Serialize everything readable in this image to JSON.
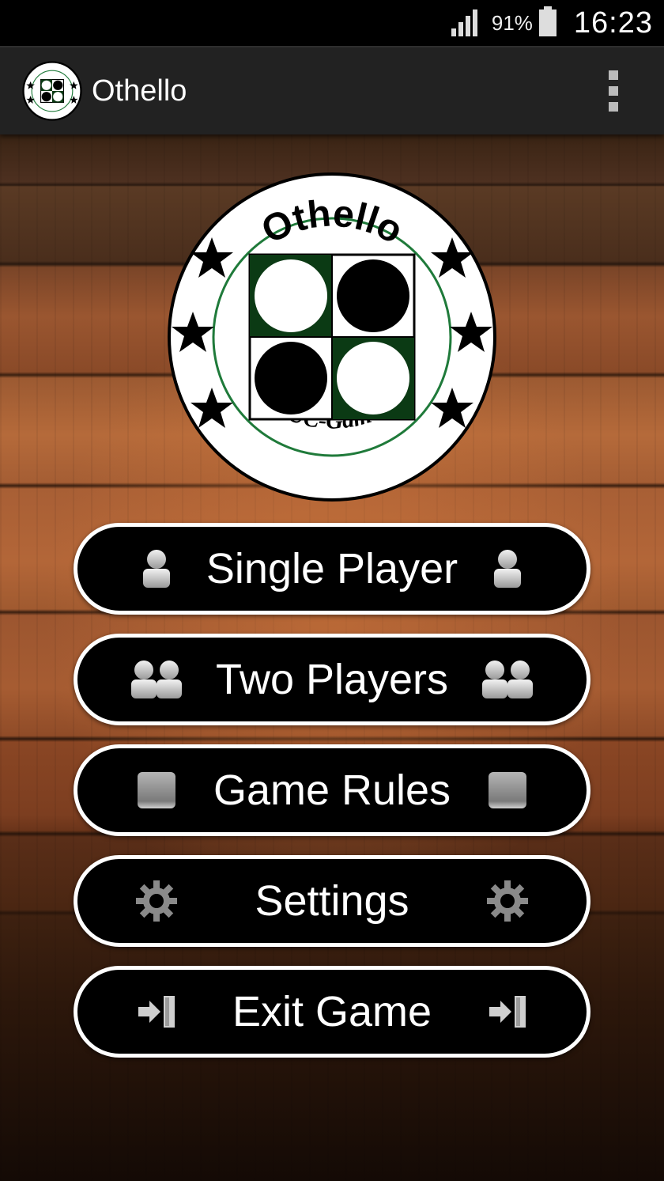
{
  "status_bar": {
    "battery_percent": "91%",
    "time": "16:23"
  },
  "action_bar": {
    "title": "Othello",
    "app_icon": "othello-logo-icon",
    "overflow_icon": "overflow-menu-icon"
  },
  "logo": {
    "top_text": "Othello",
    "bottom_text": "TUC-Games"
  },
  "menu": {
    "single_player": {
      "label": "Single Player",
      "icon": "person-icon"
    },
    "two_players": {
      "label": "Two Players",
      "icon": "two-persons-icon"
    },
    "game_rules": {
      "label": "Game Rules",
      "icon": "square-icon"
    },
    "settings": {
      "label": "Settings",
      "icon": "gear-icon"
    },
    "exit_game": {
      "label": "Exit Game",
      "icon": "exit-door-icon"
    }
  },
  "colors": {
    "board_green": "#0b3a14",
    "ring_green": "#1f7a3a",
    "button_bg": "#000000",
    "button_border": "#ffffff",
    "action_bar_bg": "#222222"
  }
}
